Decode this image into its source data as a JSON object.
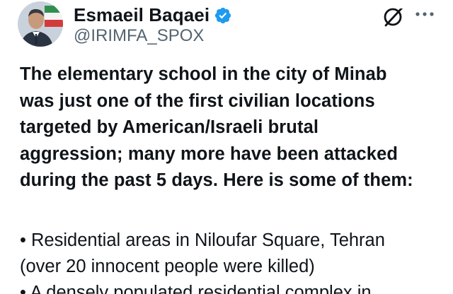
{
  "author": {
    "display_name": "Esmaeil Baqaei",
    "handle": "@IRIMFA_SPOX",
    "verified": true,
    "avatar_icon": "profile-photo-with-flag",
    "verified_color": "#1d9bf0"
  },
  "actions": {
    "grok_icon": "grok-icon",
    "more_icon": "more-dots-icon"
  },
  "tweet": {
    "lead_lines": [
      "The elementary school in the city of Minab",
      "was just one of the first civilian locations",
      "targeted by American/Israeli brutal",
      "aggression; many more have been attacked",
      "during the past 5 days. Here is some of them:"
    ],
    "bullet_lines": [
      "• Residential areas in Niloufar Square, Tehran",
      "(over 20 innocent people were killed)",
      "• A densely populated residential complex in"
    ]
  },
  "colors": {
    "text": "#0f1419",
    "secondary": "#536471",
    "background": "#ffffff"
  }
}
